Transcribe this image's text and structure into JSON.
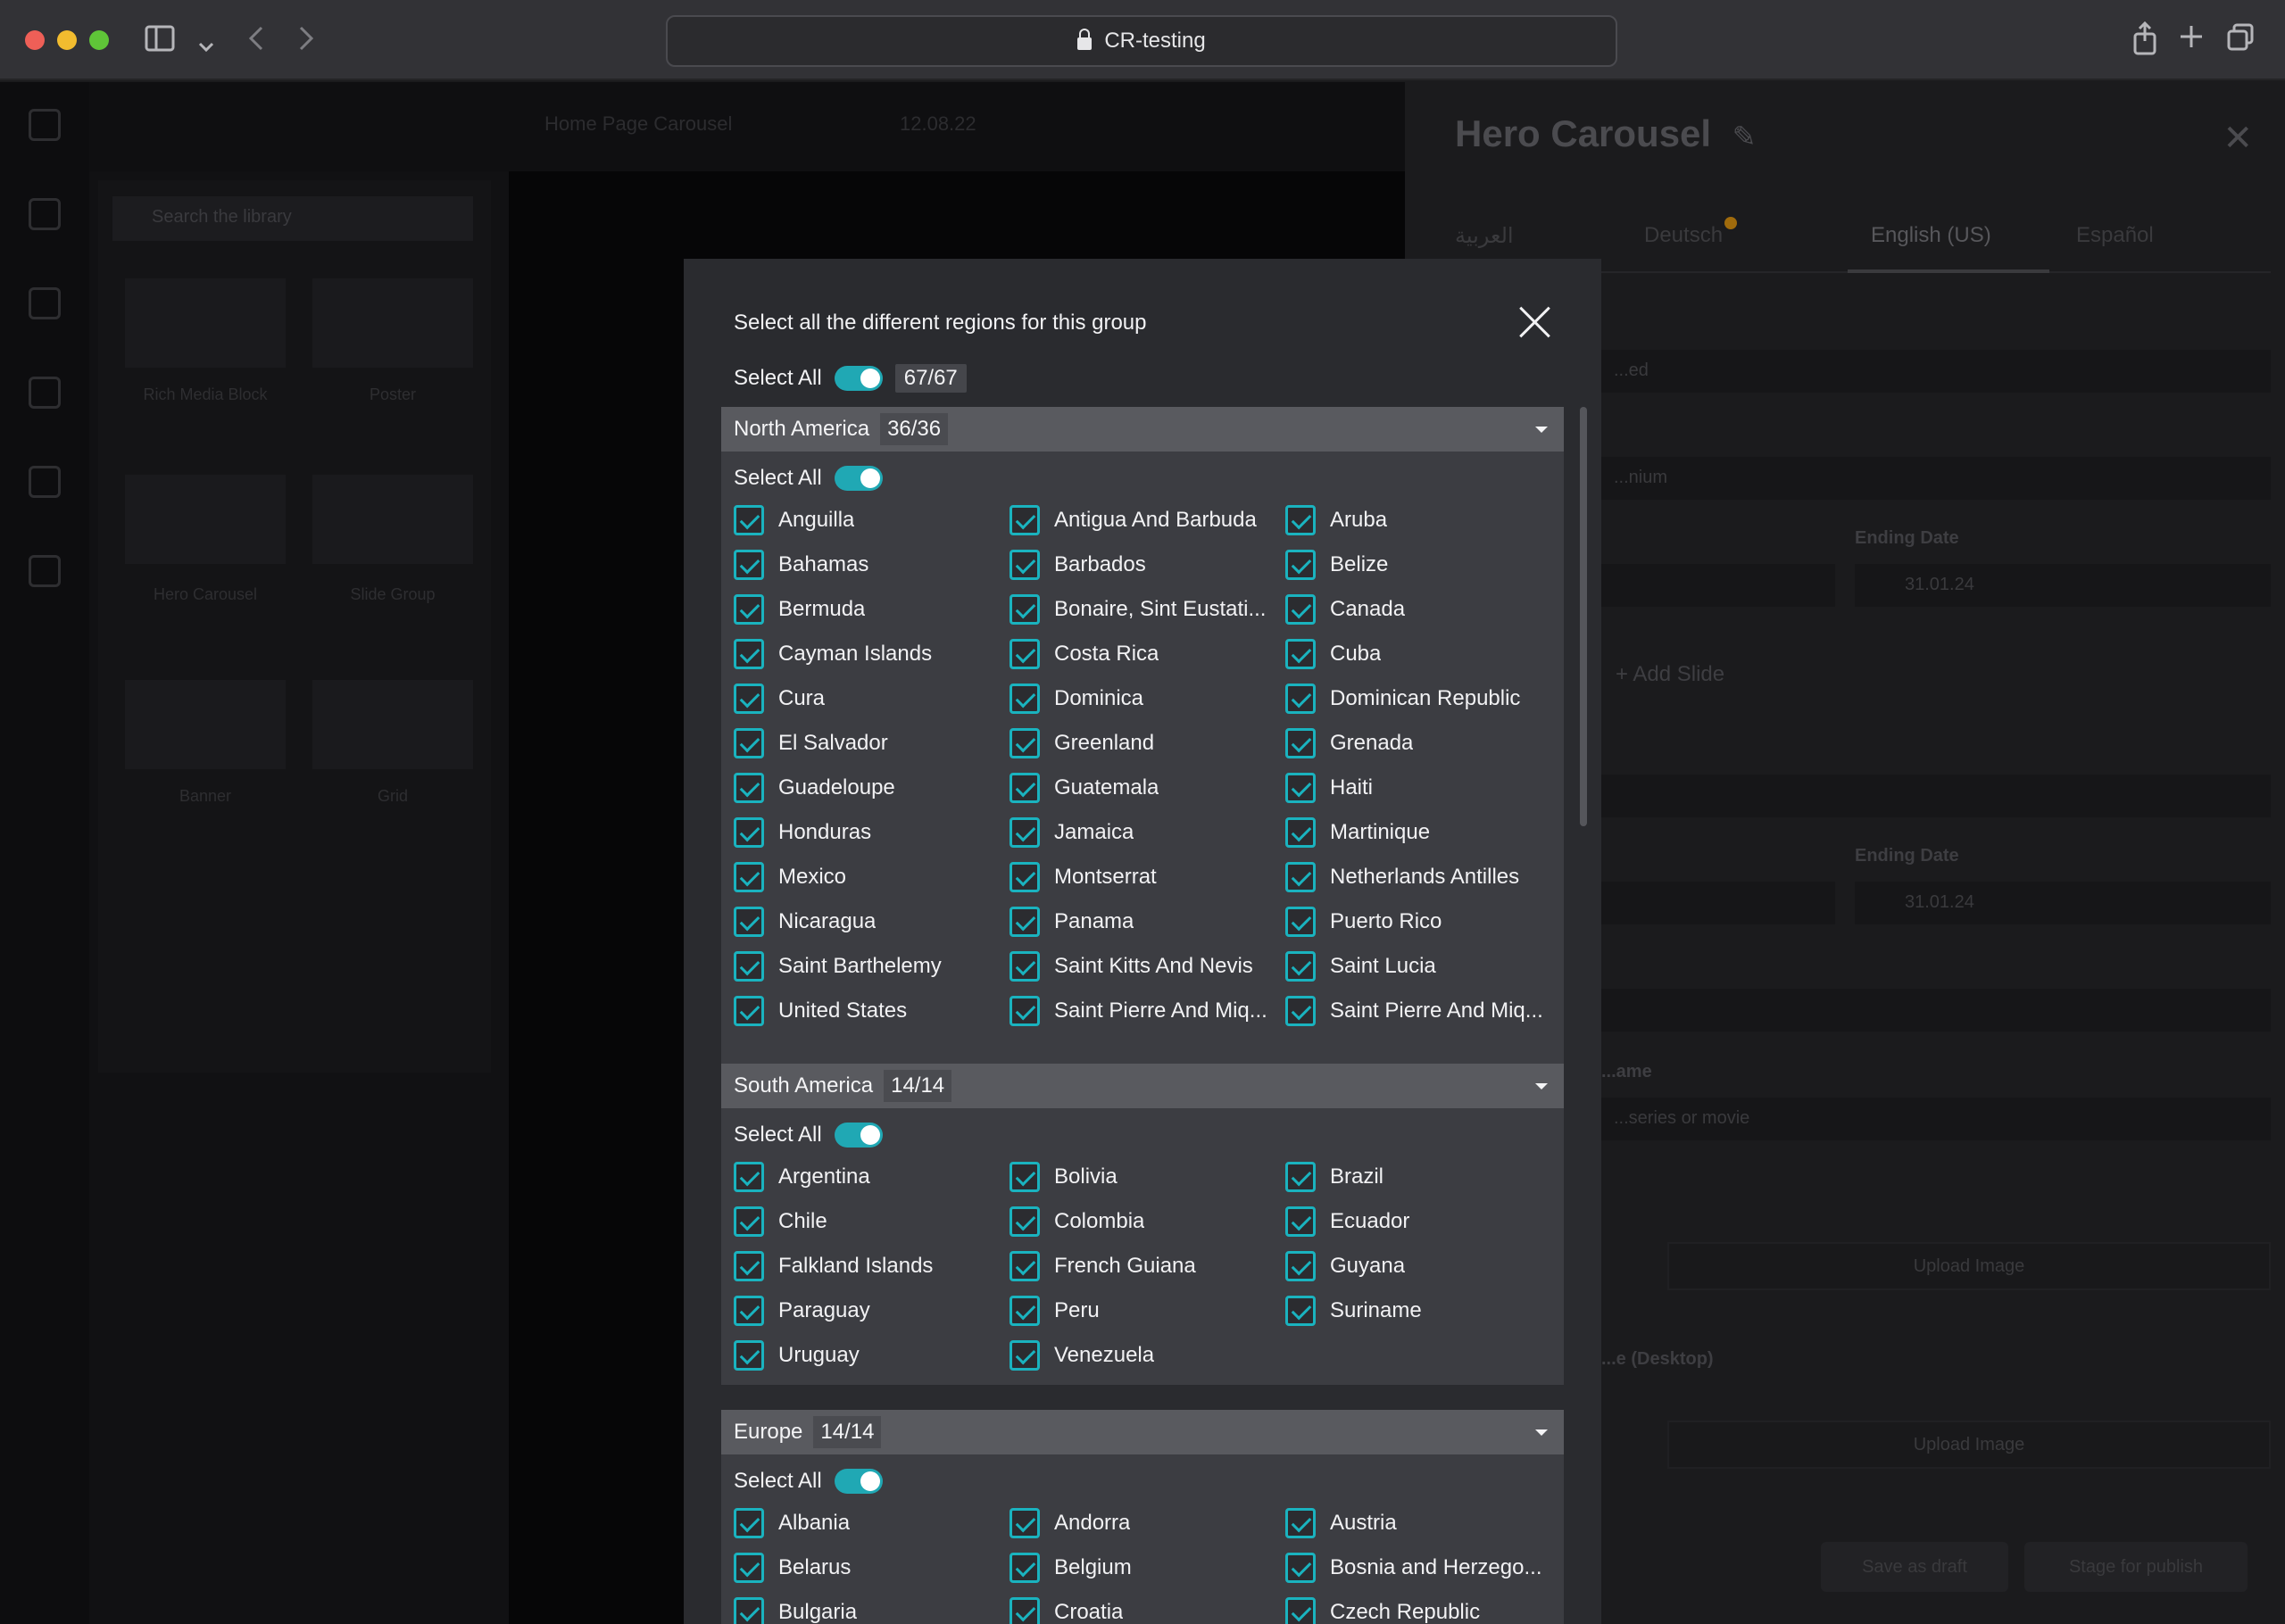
{
  "browser": {
    "url_text": "CR-testing"
  },
  "background": {
    "toolbar_text": "Home Page Carousel",
    "toolbar_date": "12.08.22",
    "library_search_placeholder": "Search the library",
    "library_tiles": [
      "Rich Media Block",
      "Poster",
      "Hero Carousel",
      "Slide Group",
      "Banner",
      "Grid"
    ],
    "panel_title": "Hero Carousel",
    "panel_tabs": [
      "العربية",
      "Deutsch",
      "English (US)",
      "Español"
    ],
    "active_tab": "English (US)",
    "field_placeholder_1": "...ed",
    "field_placeholder_2": "...nium",
    "ending_date_label": "Ending Date",
    "ending_date_value_1": "31.01.24",
    "add_slide": "+ Add Slide",
    "ending_date_value_2": "31.01.24",
    "name_label": "...ame",
    "name_placeholder": "...series or movie",
    "upload_image": "Upload Image",
    "image_desktop_label": "...e (Desktop)",
    "upload_image_2": "Upload Image",
    "save_draft": "Save as draft",
    "stage_publish": "Stage for publish"
  },
  "modal": {
    "title": "Select all the different regions for this group",
    "select_all_label": "Select All",
    "total_count": "67/67",
    "groups": [
      {
        "name": "North America",
        "count": "36/36",
        "select_all_label": "Select All",
        "items": [
          "Anguilla",
          "Antigua And Barbuda",
          "Aruba",
          "Bahamas",
          "Barbados",
          "Belize",
          "Bermuda",
          "Bonaire, Sint Eustati...",
          "Canada",
          "Cayman Islands",
          "Costa Rica",
          "Cuba",
          "Cura",
          "Dominica",
          "Dominican Republic",
          "El Salvador",
          "Greenland",
          "Grenada",
          "Guadeloupe",
          "Guatemala",
          "Haiti",
          "Honduras",
          "Jamaica",
          "Martinique",
          "Mexico",
          "Montserrat",
          "Netherlands Antilles",
          "Nicaragua",
          "Panama",
          "Puerto Rico",
          "Saint Barthelemy",
          "Saint Kitts And Nevis",
          "Saint Lucia",
          "United States",
          "Saint Pierre And Miq...",
          "Saint Pierre And Miq..."
        ]
      },
      {
        "name": "South America",
        "count": "14/14",
        "select_all_label": "Select All",
        "items": [
          "Argentina",
          "Bolivia",
          "Brazil",
          "Chile",
          "Colombia",
          "Ecuador",
          "Falkland Islands",
          "French Guiana",
          "Guyana",
          "Paraguay",
          "Peru",
          "Suriname",
          "Uruguay",
          "Venezuela"
        ]
      },
      {
        "name": "Europe",
        "count": "14/14",
        "select_all_label": "Select All",
        "items": [
          "Albania",
          "Andorra",
          "Austria",
          "Belarus",
          "Belgium",
          "Bosnia and Herzego...",
          "Bulgaria",
          "Croatia",
          "Czech Republic"
        ]
      }
    ]
  },
  "colors": {
    "accent": "#1ab3bf",
    "toggle": "#20a8b4",
    "modal_bg": "#2a2b2f",
    "group_header": "#595a5f",
    "group_body": "#3c3d42"
  },
  "icons": [
    "lock-icon",
    "close-icon",
    "chevron-down-icon",
    "checkbox-checked-icon",
    "sidebar-toggle-icon",
    "back-icon",
    "forward-icon",
    "share-icon",
    "new-tab-icon",
    "tabs-overview-icon",
    "edit-icon"
  ]
}
